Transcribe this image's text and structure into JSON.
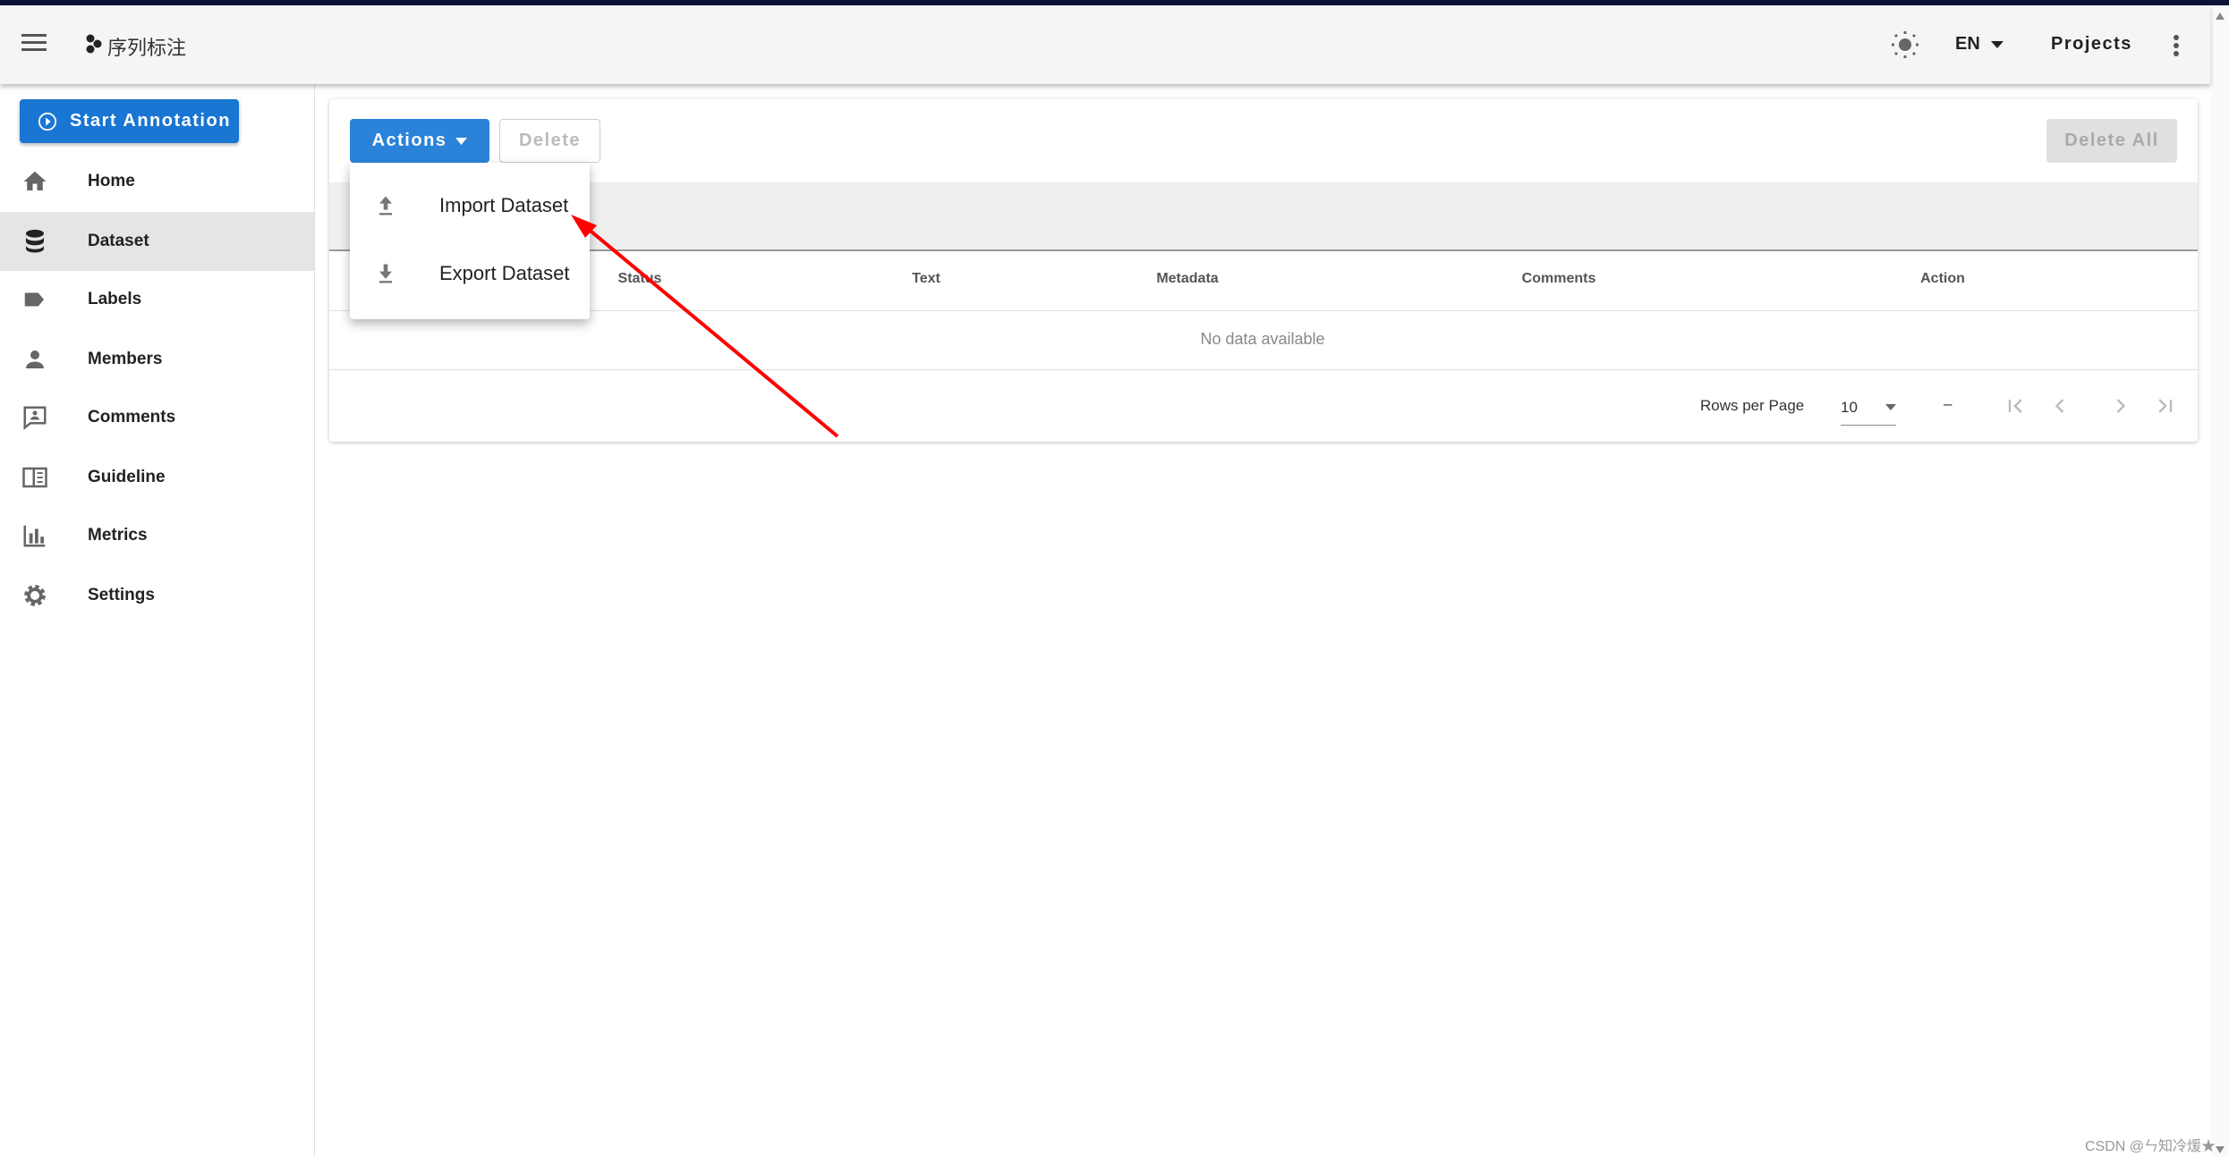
{
  "appbar": {
    "title": "序列标注",
    "language": "EN",
    "projects_label": "Projects"
  },
  "sidebar": {
    "start_annotation": "Start Annotation",
    "items": [
      {
        "label": "Home",
        "icon": "home-icon"
      },
      {
        "label": "Dataset",
        "icon": "database-icon",
        "active": true
      },
      {
        "label": "Labels",
        "icon": "label-icon"
      },
      {
        "label": "Members",
        "icon": "person-icon"
      },
      {
        "label": "Comments",
        "icon": "comment-icon"
      },
      {
        "label": "Guideline",
        "icon": "book-icon"
      },
      {
        "label": "Metrics",
        "icon": "bar-chart-icon"
      },
      {
        "label": "Settings",
        "icon": "gear-icon"
      }
    ]
  },
  "toolbar": {
    "actions_label": "Actions",
    "delete_label": "Delete",
    "delete_all_label": "Delete All"
  },
  "menu": {
    "items": [
      {
        "label": "Import Dataset",
        "icon": "upload-icon"
      },
      {
        "label": "Export Dataset",
        "icon": "download-icon"
      }
    ]
  },
  "table": {
    "columns": [
      "Status",
      "Text",
      "Metadata",
      "Comments",
      "Action"
    ],
    "empty_text": "No data available"
  },
  "pagination": {
    "rows_per_page_label": "Rows per Page",
    "rows_per_page": "10",
    "range": "–"
  },
  "annotation": {
    "arrow_color": "#ff0000"
  },
  "watermark": "CSDN @ㄣ知冷煖★",
  "colors": {
    "primary": "#1976d2",
    "topstrip": "#0b1437"
  }
}
